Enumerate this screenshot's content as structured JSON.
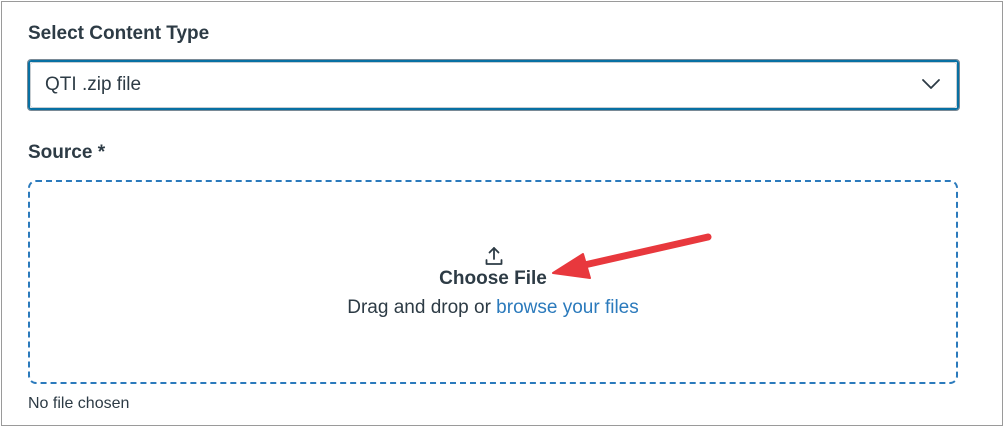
{
  "content_type": {
    "label": "Select Content Type",
    "selected_value": "QTI .zip file"
  },
  "source": {
    "label": "Source *",
    "choose_file": "Choose File",
    "drag_text": "Drag and drop or ",
    "browse_link": "browse your files",
    "status": "No file chosen"
  },
  "icons": {
    "dropdown": "chevron-down-icon",
    "upload": "upload-icon"
  },
  "colors": {
    "accent": "#2b7abc",
    "annotation": "#e8383d",
    "text": "#2d3b45"
  }
}
